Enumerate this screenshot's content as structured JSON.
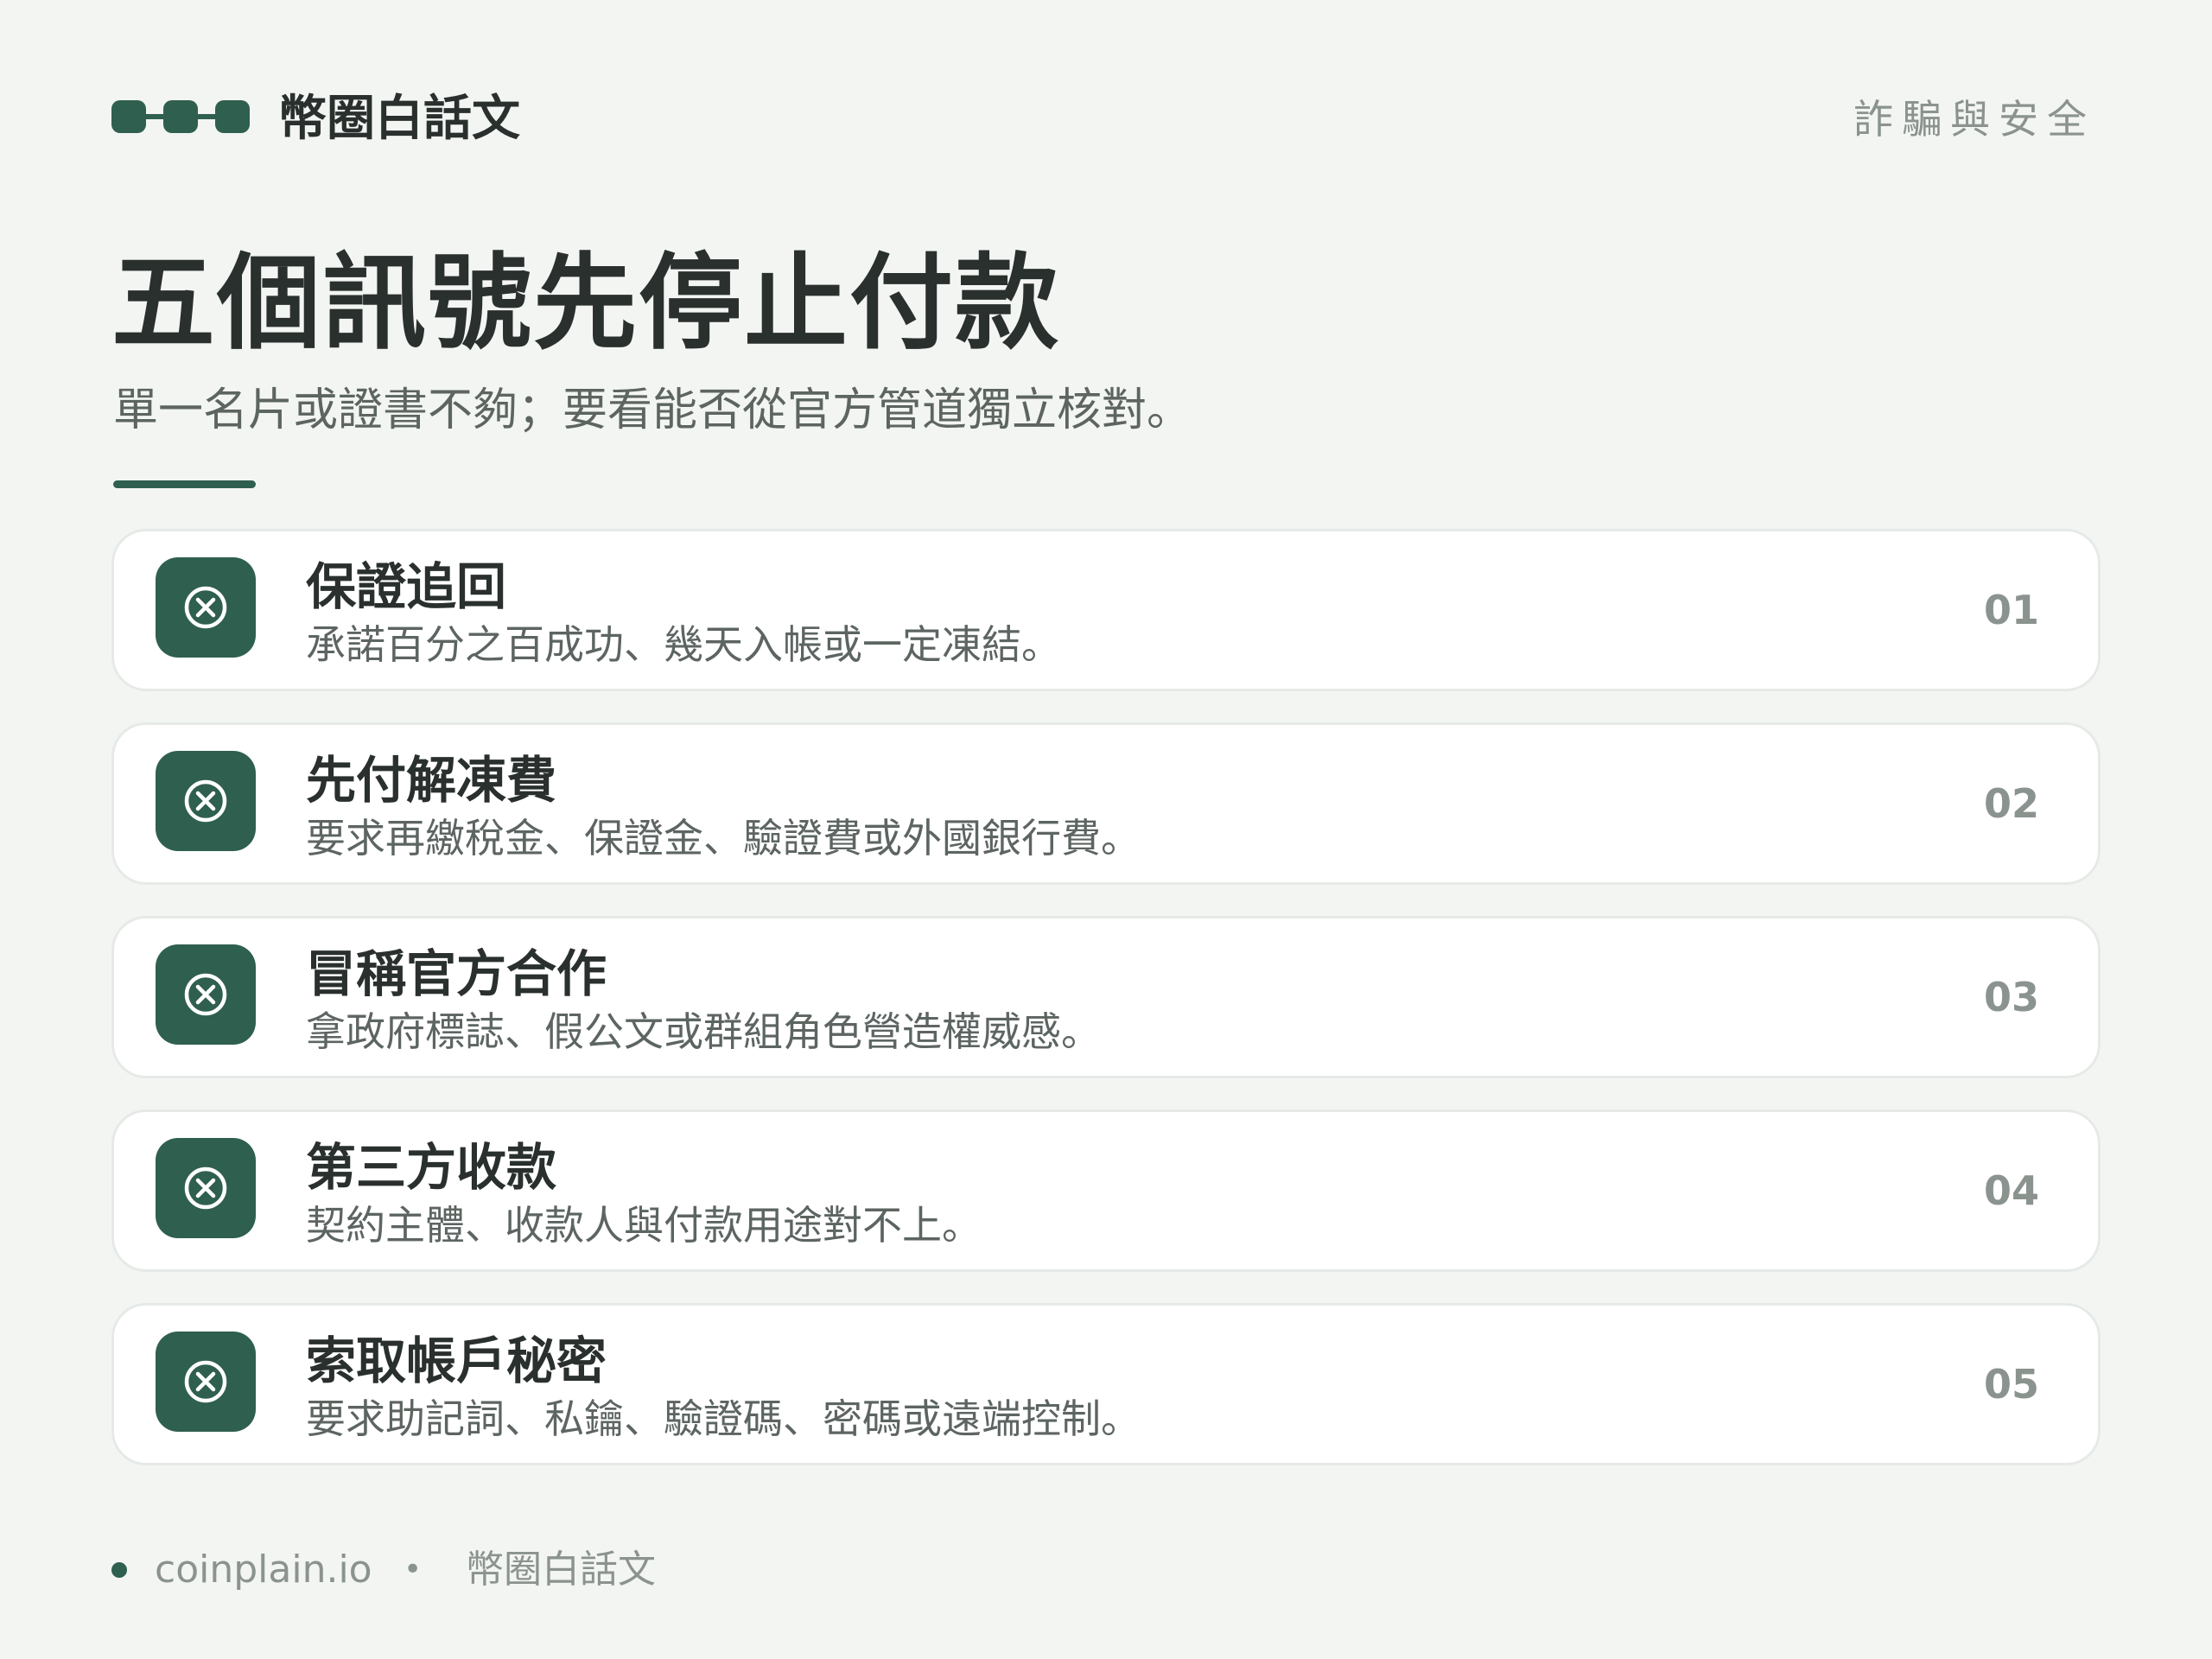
{
  "header": {
    "brand_name": "幣圈白話文",
    "category": "詐騙與安全",
    "logo_icon": "chain-link-logo"
  },
  "main": {
    "title": "五個訊號先停止付款",
    "subtitle": "單一名片或證書不夠；要看能否從官方管道獨立核對。"
  },
  "signals": [
    {
      "title": "保證追回",
      "description": "承諾百分之百成功、幾天入帳或一定凍結。",
      "number": "01",
      "icon": "circle-x-icon"
    },
    {
      "title": "先付解凍費",
      "description": "要求再繳稅金、保證金、驗證費或外國銀行費。",
      "number": "02",
      "icon": "circle-x-icon"
    },
    {
      "title": "冒稱官方合作",
      "description": "拿政府標誌、假公文或群組角色營造權威感。",
      "number": "03",
      "icon": "circle-x-icon"
    },
    {
      "title": "第三方收款",
      "description": "契約主體、收款人與付款用途對不上。",
      "number": "04",
      "icon": "circle-x-icon"
    },
    {
      "title": "索取帳戶秘密",
      "description": "要求助記詞、私鑰、驗證碼、密碼或遠端控制。",
      "number": "05",
      "icon": "circle-x-icon"
    }
  ],
  "footer": {
    "site": "coinplain.io",
    "separator": "•",
    "brand": "幣圈白話文"
  },
  "colors": {
    "accent": "#2f5f4f",
    "background": "#f3f5f3",
    "text": "#2a302d",
    "muted": "#8b938f"
  }
}
